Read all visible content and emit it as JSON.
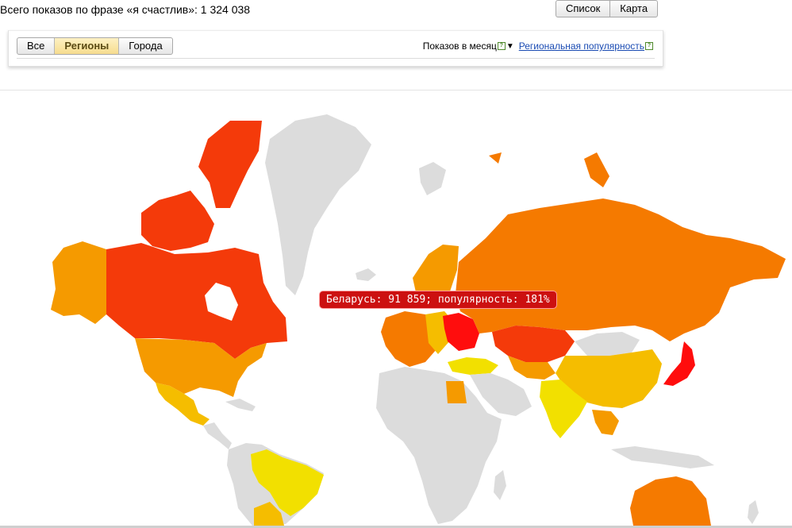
{
  "header": {
    "total_text": "Всего показов по фразе «я счастлив»: 1 324 038"
  },
  "view_switch": {
    "list_label": "Список",
    "map_label": "Карта"
  },
  "tabs": [
    {
      "label": "Все"
    },
    {
      "label": "Регионы",
      "active": true
    },
    {
      "label": "Города"
    }
  ],
  "panel": {
    "shows_label": "Показов в месяц",
    "help_glyph": "?",
    "regional_label": "Региональная популярность"
  },
  "tooltip": {
    "text": "Беларусь: 91 859; популярность: 181%"
  },
  "colors": {
    "no_data": "#dcdcdc",
    "high": "#ff0d0d",
    "upper": "#f43a0a",
    "mid": "#f57a00",
    "midlow": "#f59a00",
    "low": "#f5bd00",
    "lowest": "#f2e000",
    "tooltip_bg": "#cc1010"
  }
}
